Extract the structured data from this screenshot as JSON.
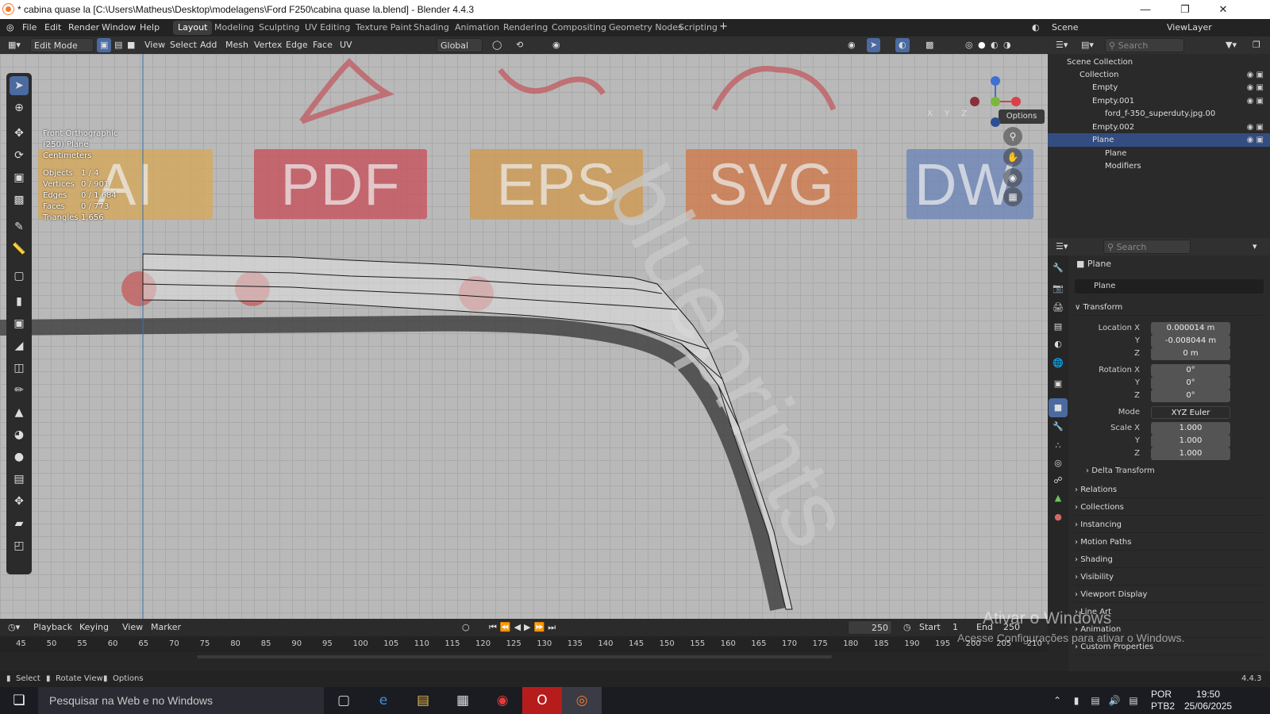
{
  "window": {
    "title": "* cabina quase la [C:\\Users\\Matheus\\Desktop\\modelagens\\Ford F250\\cabina quase la.blend] - Blender 4.4.3"
  },
  "menu": [
    "File",
    "Edit",
    "Render",
    "Window",
    "Help"
  ],
  "workspaces": [
    "Layout",
    "Modeling",
    "Sculpting",
    "UV Editing",
    "Texture Paint",
    "Shading",
    "Animation",
    "Rendering",
    "Compositing",
    "Geometry Nodes",
    "Scripting"
  ],
  "active_workspace": "Layout",
  "scene": {
    "label": "Scene",
    "viewlayer": "ViewLayer"
  },
  "header3d": {
    "mode": "Edit Mode",
    "menus": [
      "View",
      "Select",
      "Add",
      "Mesh",
      "Vertex",
      "Edge",
      "Face",
      "UV"
    ],
    "orientation": "Global",
    "options": "Options",
    "axes": "X Y Z"
  },
  "viewport": {
    "view_name": "Front Orthographic",
    "object_line": "(250) Plane",
    "units": "Centimeters",
    "stats": [
      {
        "k": "Objects",
        "v": "1 / 4"
      },
      {
        "k": "Vertices",
        "v": "0 / 901"
      },
      {
        "k": "Edges",
        "v": "0 / 1,684"
      },
      {
        "k": "Faces",
        "v": "0 / 773"
      },
      {
        "k": "Triangles",
        "v": "1,656"
      }
    ],
    "logos": [
      "AI",
      "PDF",
      "EPS",
      "SVG",
      "DW"
    ],
    "logo_colors": [
      "#d6a85a",
      "#c8505a",
      "#d09a50",
      "#d07848",
      "#6c85b8"
    ],
    "watermark_text": "blueprints"
  },
  "timeline": {
    "menus": [
      "Playback",
      "Keying",
      "View",
      "Marker"
    ],
    "current_frame": "250",
    "start_label": "Start",
    "start": "1",
    "end_label": "End",
    "end": "250",
    "ticks": [
      "45",
      "50",
      "55",
      "60",
      "65",
      "70",
      "75",
      "80",
      "85",
      "90",
      "95",
      "100",
      "105",
      "110",
      "115",
      "120",
      "125",
      "130",
      "135",
      "140",
      "145",
      "150",
      "155",
      "160",
      "165",
      "170",
      "175",
      "180",
      "185",
      "190",
      "195",
      "200",
      "205",
      "210"
    ]
  },
  "statusbar": {
    "select": "Select",
    "rotate": "Rotate View",
    "options": "Options",
    "version": "4.4.3"
  },
  "outliner": {
    "search": "Search",
    "items": [
      {
        "label": "Scene Collection",
        "indent": 0
      },
      {
        "label": "Collection",
        "indent": 1
      },
      {
        "label": "Empty",
        "indent": 2
      },
      {
        "label": "Empty.001",
        "indent": 2
      },
      {
        "label": "ford_f-350_superduty.jpg.00",
        "indent": 3
      },
      {
        "label": "Empty.002",
        "indent": 2
      },
      {
        "label": "Plane",
        "indent": 2,
        "selected": true
      },
      {
        "label": "Plane",
        "indent": 3
      },
      {
        "label": "Modifiers",
        "indent": 3
      }
    ]
  },
  "properties": {
    "search": "Search",
    "object_name": "Plane",
    "datablock": "Plane",
    "transform_label": "Transform",
    "rows": [
      {
        "k": "Location X",
        "v": "0.000014 m"
      },
      {
        "k": "Y",
        "v": "-0.008044 m"
      },
      {
        "k": "Z",
        "v": "0 m"
      },
      {
        "k": "Rotation X",
        "v": "0°"
      },
      {
        "k": "Y",
        "v": "0°"
      },
      {
        "k": "Z",
        "v": "0°"
      },
      {
        "k": "Mode",
        "v": "XYZ Euler"
      },
      {
        "k": "Scale X",
        "v": "1.000"
      },
      {
        "k": "Y",
        "v": "1.000"
      },
      {
        "k": "Z",
        "v": "1.000"
      }
    ],
    "delta": "Delta Transform",
    "sections": [
      "Relations",
      "Collections",
      "Instancing",
      "Motion Paths",
      "Shading",
      "Visibility",
      "Viewport Display",
      "Line Art",
      "Animation",
      "Custom Properties"
    ]
  },
  "activation": {
    "title": "Ativar o Windows",
    "subtitle": "Acesse Configurações para ativar o Windows."
  },
  "taskbar": {
    "search_placeholder": "Pesquisar na Web e no Windows",
    "lang": "POR",
    "layout": "PTB2",
    "time": "19:50",
    "date": "25/06/2025"
  }
}
